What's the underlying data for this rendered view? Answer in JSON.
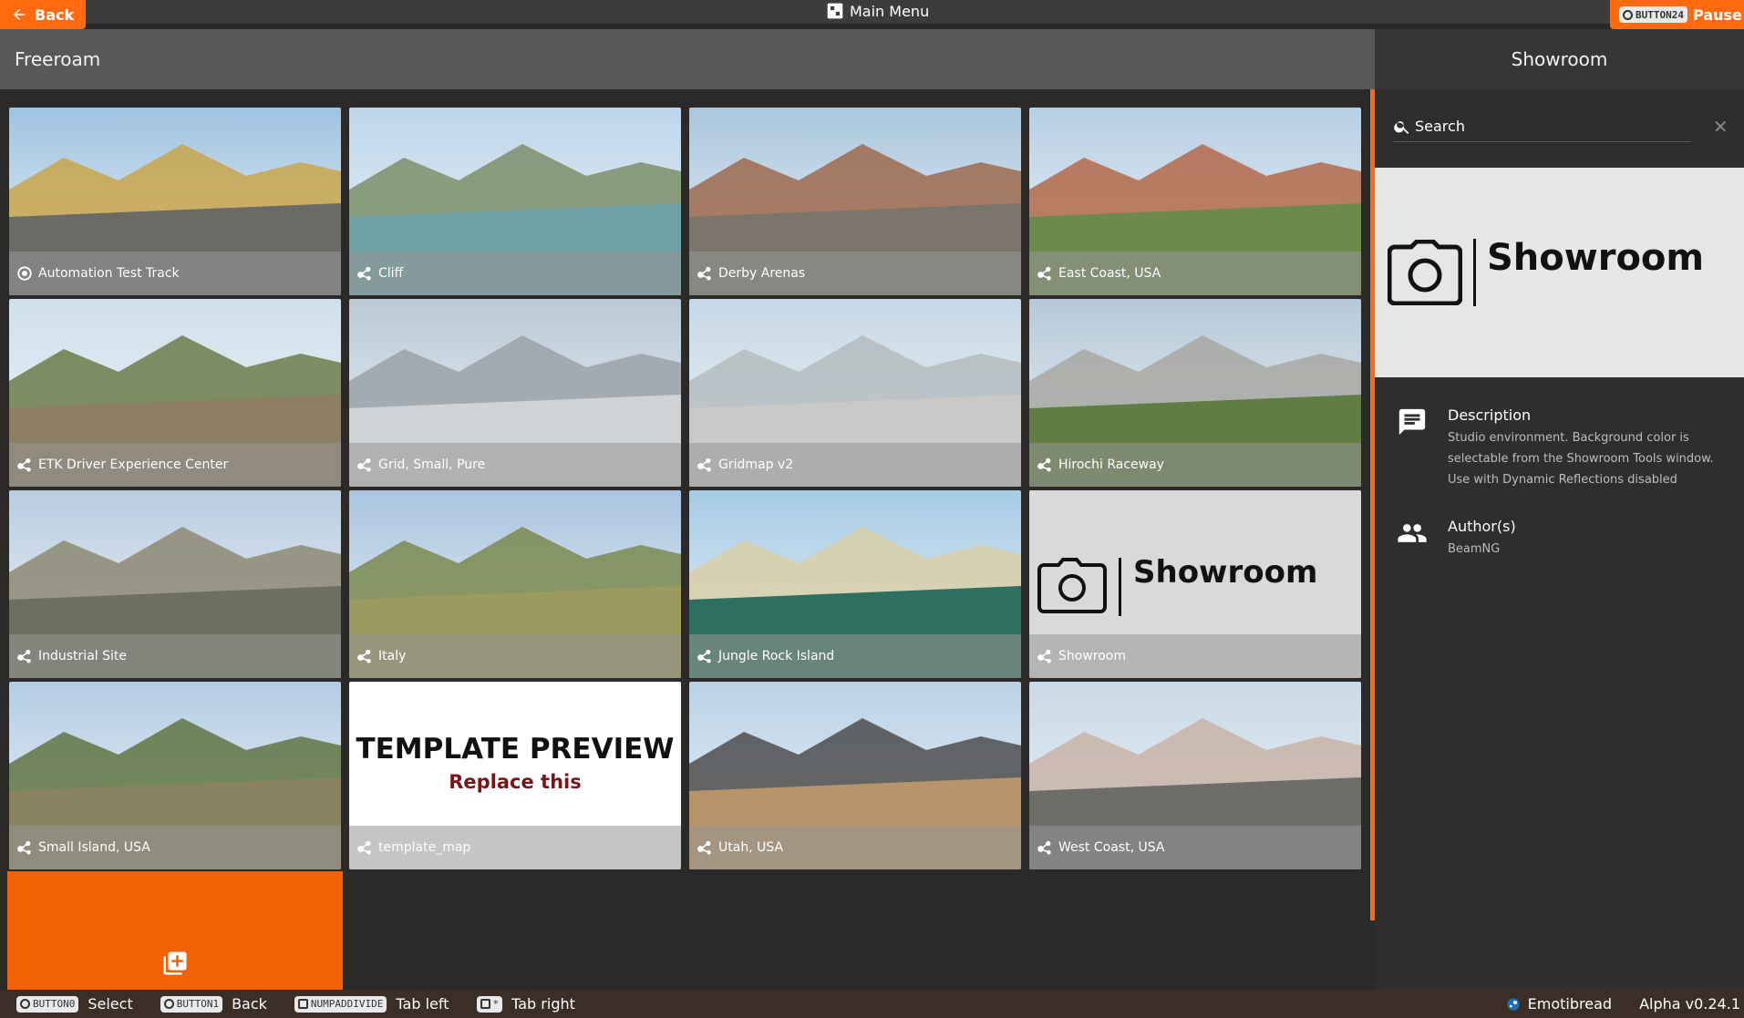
{
  "topbar": {
    "back_label": "Back",
    "main_menu_label": "Main Menu",
    "pause_key": "BUTTON24",
    "pause_label": "Pause"
  },
  "left": {
    "title": "Freeroam"
  },
  "tiles": [
    {
      "name": "Automation Test Track",
      "icon": "automation-icon"
    },
    {
      "name": "Cliff",
      "icon": "beamng-icon"
    },
    {
      "name": "Derby Arenas",
      "icon": "beamng-icon"
    },
    {
      "name": "East Coast, USA",
      "icon": "beamng-icon"
    },
    {
      "name": "ETK Driver Experience Center",
      "icon": "beamng-icon"
    },
    {
      "name": "Grid, Small, Pure",
      "icon": "beamng-icon"
    },
    {
      "name": "Gridmap v2",
      "icon": "beamng-icon"
    },
    {
      "name": "Hirochi Raceway",
      "icon": "beamng-icon"
    },
    {
      "name": "Industrial Site",
      "icon": "beamng-icon"
    },
    {
      "name": "Italy",
      "icon": "beamng-icon"
    },
    {
      "name": "Jungle Rock Island",
      "icon": "beamng-icon"
    },
    {
      "name": "Showroom",
      "icon": "beamng-icon"
    },
    {
      "name": "Small Island, USA",
      "icon": "beamng-icon"
    },
    {
      "name": "template_map",
      "icon": "beamng-icon"
    },
    {
      "name": "Utah, USA",
      "icon": "beamng-icon"
    },
    {
      "name": "West Coast, USA",
      "icon": "beamng-icon"
    }
  ],
  "showroom_thumb_text": "Showroom",
  "template_preview": {
    "line1": "TEMPLATE PREVIEW",
    "line2": "Replace this"
  },
  "right": {
    "title": "Showroom",
    "search_placeholder": "Search",
    "preview_text": "Showroom",
    "description_title": "Description",
    "description_text": "Studio environment. Background color is selectable from the Showroom Tools window. Use with Dynamic Reflections disabled",
    "authors_title": "Author(s)",
    "authors_text": "BeamNG"
  },
  "bottombar": {
    "hints": [
      {
        "key": "BUTTON0",
        "label": "Select"
      },
      {
        "key": "BUTTON1",
        "label": "Back"
      },
      {
        "key": "NUMPADDIVIDE",
        "label": "Tab left"
      },
      {
        "key": "*",
        "label": "Tab right"
      }
    ],
    "username": "Emotibread",
    "version": "Alpha v0.24.1"
  },
  "colors": {
    "accent": "#ff6a10",
    "header": "#585858",
    "panel": "#2f2e2d"
  }
}
